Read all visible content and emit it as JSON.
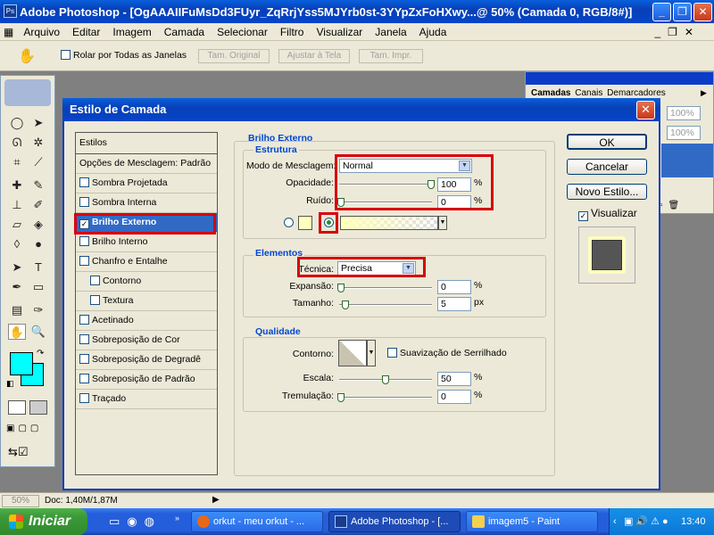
{
  "app": {
    "title": "Adobe Photoshop - [OgAAAIIFuMsDd3FUyr_ZqRrjYss5MJYrb0st-3YYpZxFoHXwy...@ 50% (Camada 0, RGB/8#)]"
  },
  "menu": [
    "Arquivo",
    "Editar",
    "Imagem",
    "Camada",
    "Selecionar",
    "Filtro",
    "Visualizar",
    "Janela",
    "Ajuda"
  ],
  "options": {
    "scroll_all": "Rolar por Todas as Janelas",
    "actual": "Tam. Original",
    "fit": "Ajustar à Tela",
    "print": "Tam. Impr."
  },
  "panel": {
    "tabs": [
      "Camadas",
      "Canais",
      "Demarcadores"
    ],
    "zoom1": "100%",
    "zoom2": "100%"
  },
  "dialog": {
    "title": "Estilo de Camada",
    "styles_header": "Estilos",
    "blend_options": "Opções de Mesclagem: Padrão",
    "styles": [
      {
        "label": "Sombra Projetada",
        "checked": false,
        "indent": false
      },
      {
        "label": "Sombra Interna",
        "checked": false,
        "indent": false
      },
      {
        "label": "Brilho Externo",
        "checked": true,
        "indent": false,
        "selected": true
      },
      {
        "label": "Brilho Interno",
        "checked": false,
        "indent": false
      },
      {
        "label": "Chanfro e Entalhe",
        "checked": false,
        "indent": false
      },
      {
        "label": "Contorno",
        "checked": false,
        "indent": true
      },
      {
        "label": "Textura",
        "checked": false,
        "indent": true
      },
      {
        "label": "Acetinado",
        "checked": false,
        "indent": false
      },
      {
        "label": "Sobreposição de Cor",
        "checked": false,
        "indent": false
      },
      {
        "label": "Sobreposição de Degradê",
        "checked": false,
        "indent": false
      },
      {
        "label": "Sobreposição de Padrão",
        "checked": false,
        "indent": false
      },
      {
        "label": "Traçado",
        "checked": false,
        "indent": false
      }
    ],
    "section_title": "Brilho Externo",
    "estrutura": {
      "title": "Estrutura",
      "blend_mode_label": "Modo de Mesclagem:",
      "blend_mode": "Normal",
      "opacity_label": "Opacidade:",
      "opacity": "100",
      "noise_label": "Ruído:",
      "noise": "0",
      "pct": "%"
    },
    "elementos": {
      "title": "Elementos",
      "technique_label": "Técnica:",
      "technique": "Precisa",
      "spread_label": "Expansão:",
      "spread": "0",
      "size_label": "Tamanho:",
      "size": "5",
      "px": "px",
      "pct": "%"
    },
    "qualidade": {
      "title": "Qualidade",
      "contour_label": "Contorno:",
      "antialias_label": "Suavização de Serrilhado",
      "range_label": "Escala:",
      "range": "50",
      "jitter_label": "Tremulação:",
      "jitter": "0",
      "pct": "%"
    },
    "buttons": {
      "ok": "OK",
      "cancel": "Cancelar",
      "new_style": "Novo Estilo...",
      "preview": "Visualizar"
    }
  },
  "status": {
    "zoom": "50%",
    "doc": "Doc: 1,40M/1,87M"
  },
  "taskbar": {
    "start": "Iniciar",
    "tasks": [
      "orkut - meu orkut - ...",
      "Adobe Photoshop - [...",
      "imagem5 - Paint"
    ],
    "clock": "13:40"
  },
  "colors": {
    "foreground": "#00ffff",
    "background": "#00ffff",
    "glow": "#ffffbe",
    "highlight": "#d8000c"
  }
}
